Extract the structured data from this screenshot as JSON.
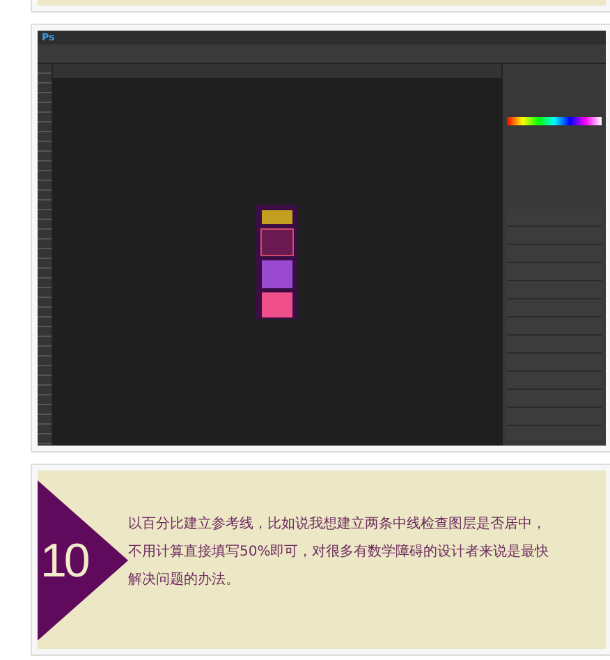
{
  "screenshot": {
    "app_logo": "Ps"
  },
  "step": {
    "number": "10",
    "lines": [
      "以百分比建立参考线，比如说我想建立两条中线检查图层是否居中，",
      "不用计算直接填写50%即可，对很多有数学障碍的设计者来说是最快",
      "解决问题的办法。"
    ]
  }
}
